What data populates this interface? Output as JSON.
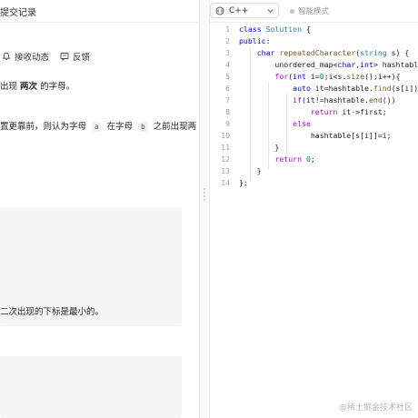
{
  "left": {
    "tab_label": "提交记录",
    "toolbar": {
      "subscribe_label": "接收动态",
      "feedback_label": "反馈"
    },
    "desc_line1_pre": "出现 ",
    "desc_line1_bold": "两次",
    "desc_line1_post": " 的字母。",
    "desc_line2_pre": "置更靠前，则认为字母 ",
    "desc_line2_chip_a": "a",
    "desc_line2_mid": " 在字母 ",
    "desc_line2_chip_b": "b",
    "desc_line2_post": " 之前出现两",
    "example_text": "二次出现的下标是最小的。"
  },
  "editor": {
    "language": "C++",
    "smart_mode_label": "智能模式",
    "lines": [
      {
        "n": "1",
        "tokens": [
          {
            "t": "class ",
            "c": "t-kw"
          },
          {
            "t": "Solution",
            "c": "t-cl"
          },
          {
            "t": " {",
            "c": "t-pl"
          }
        ]
      },
      {
        "n": "2",
        "tokens": [
          {
            "t": "public:",
            "c": "t-kw"
          }
        ]
      },
      {
        "n": "3",
        "tokens": [
          {
            "t": "    ",
            "c": "t-pl"
          },
          {
            "t": "char",
            "c": "t-kw"
          },
          {
            "t": " ",
            "c": "t-pl"
          },
          {
            "t": "repeatedCharacter",
            "c": "t-fn"
          },
          {
            "t": "(",
            "c": "t-pl"
          },
          {
            "t": "string",
            "c": "t-cl"
          },
          {
            "t": " s) {",
            "c": "t-pl"
          }
        ]
      },
      {
        "n": "4",
        "tokens": [
          {
            "t": "        unordered_map<",
            "c": "t-pl"
          },
          {
            "t": "char",
            "c": "t-kw"
          },
          {
            "t": ",",
            "c": "t-pl"
          },
          {
            "t": "int",
            "c": "t-kw"
          },
          {
            "t": "> hashtable;",
            "c": "t-pl"
          }
        ]
      },
      {
        "n": "5",
        "tokens": [
          {
            "t": "        ",
            "c": "t-pl"
          },
          {
            "t": "for",
            "c": "t-ctrl"
          },
          {
            "t": "(",
            "c": "t-pl"
          },
          {
            "t": "int",
            "c": "t-kw"
          },
          {
            "t": " i=",
            "c": "t-pl"
          },
          {
            "t": "0",
            "c": "t-nm"
          },
          {
            "t": ";i<s.",
            "c": "t-pl"
          },
          {
            "t": "size",
            "c": "t-fn"
          },
          {
            "t": "();i++){",
            "c": "t-pl"
          }
        ]
      },
      {
        "n": "6",
        "tokens": [
          {
            "t": "            ",
            "c": "t-pl"
          },
          {
            "t": "auto",
            "c": "t-kw"
          },
          {
            "t": " it=hashtable.",
            "c": "t-pl"
          },
          {
            "t": "find",
            "c": "t-fn"
          },
          {
            "t": "(s[i]);",
            "c": "t-pl"
          }
        ]
      },
      {
        "n": "7",
        "tokens": [
          {
            "t": "            ",
            "c": "t-pl"
          },
          {
            "t": "if",
            "c": "t-ctrl"
          },
          {
            "t": "(it!=hashtable.",
            "c": "t-pl"
          },
          {
            "t": "end",
            "c": "t-fn"
          },
          {
            "t": "())",
            "c": "t-pl"
          }
        ]
      },
      {
        "n": "8",
        "tokens": [
          {
            "t": "                ",
            "c": "t-pl"
          },
          {
            "t": "return",
            "c": "t-ctrl"
          },
          {
            "t": " it->first;",
            "c": "t-pl"
          }
        ]
      },
      {
        "n": "9",
        "tokens": [
          {
            "t": "            ",
            "c": "t-pl"
          },
          {
            "t": "else",
            "c": "t-ctrl"
          }
        ]
      },
      {
        "n": "10",
        "tokens": [
          {
            "t": "                hashtable[s[i]]=i;",
            "c": "t-pl"
          }
        ]
      },
      {
        "n": "11",
        "tokens": [
          {
            "t": "        }",
            "c": "t-pl"
          }
        ]
      },
      {
        "n": "12",
        "tokens": [
          {
            "t": "        ",
            "c": "t-pl"
          },
          {
            "t": "return",
            "c": "t-ctrl"
          },
          {
            "t": " ",
            "c": "t-pl"
          },
          {
            "t": "0",
            "c": "t-nm"
          },
          {
            "t": ";",
            "c": "t-pl"
          }
        ]
      },
      {
        "n": "13",
        "tokens": [
          {
            "t": "    }",
            "c": "t-pl"
          }
        ]
      },
      {
        "n": "14",
        "tokens": [
          {
            "t": "};",
            "c": "t-pl"
          }
        ]
      }
    ]
  },
  "watermark": "@稀土掘金技术社区"
}
